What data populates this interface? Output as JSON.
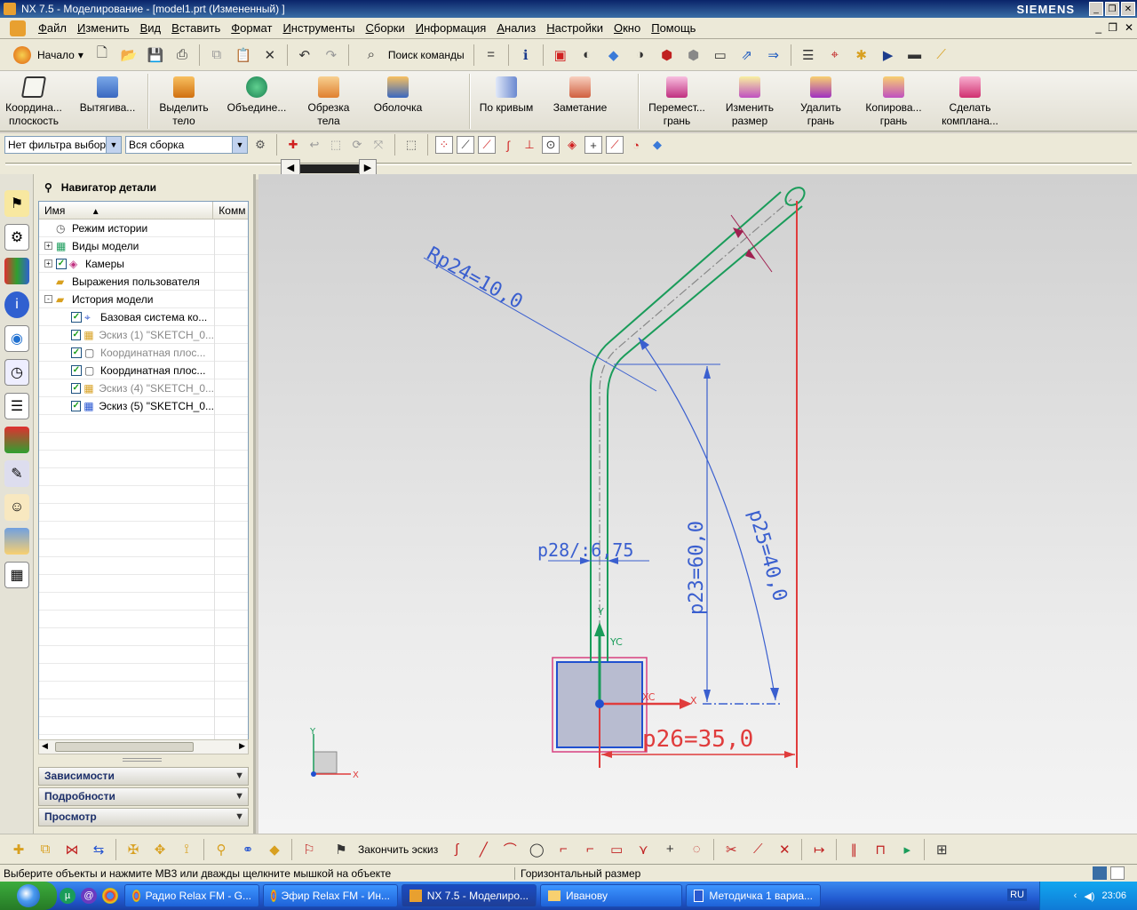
{
  "window": {
    "title": "NX 7.5 - Моделирование - [model1.prt (Измененный) ]",
    "brand": "SIEMENS"
  },
  "menu": {
    "items": [
      "Файл",
      "Изменить",
      "Вид",
      "Вставить",
      "Формат",
      "Инструменты",
      "Сборки",
      "Информация",
      "Анализ",
      "Настройки",
      "Окно",
      "Помощь"
    ]
  },
  "toolbar": {
    "start_label": "Начало",
    "search_label": "Поиск команды"
  },
  "ribbon": {
    "buttons": [
      {
        "line1": "Координа...",
        "line2": "плоскость"
      },
      {
        "line1": "Вытягива...",
        "line2": ""
      },
      {
        "line1": "Выделить",
        "line2": "тело"
      },
      {
        "line1": "Объедине...",
        "line2": ""
      },
      {
        "line1": "Обрезка",
        "line2": "тела"
      },
      {
        "line1": "Оболочка",
        "line2": ""
      },
      {
        "line1": "По кривым",
        "line2": ""
      },
      {
        "line1": "Заметание",
        "line2": ""
      },
      {
        "line1": "Перемест...",
        "line2": "грань"
      },
      {
        "line1": "Изменить",
        "line2": "размер"
      },
      {
        "line1": "Удалить",
        "line2": "грань"
      },
      {
        "line1": "Копирова...",
        "line2": "грань"
      },
      {
        "line1": "Сделать",
        "line2": "комплана..."
      }
    ]
  },
  "filter": {
    "selection_filter": "Нет фильтра выбор",
    "assembly_scope": "Вся сборка"
  },
  "navigator": {
    "title": "Навигатор детали",
    "col_name": "Имя",
    "col_comment": "Комм",
    "rows": [
      {
        "label": "Режим истории",
        "indent": 0,
        "expander": "",
        "check": false,
        "grey": false
      },
      {
        "label": "Виды модели",
        "indent": 0,
        "expander": "+",
        "check": false,
        "grey": false
      },
      {
        "label": "Камеры",
        "indent": 0,
        "expander": "+",
        "check": true,
        "grey": false
      },
      {
        "label": "Выражения пользователя",
        "indent": 0,
        "expander": "",
        "check": false,
        "grey": false
      },
      {
        "label": "История модели",
        "indent": 0,
        "expander": "-",
        "check": false,
        "grey": false
      },
      {
        "label": "Базовая система ко...",
        "indent": 1,
        "expander": "",
        "check": true,
        "grey": false
      },
      {
        "label": "Эскиз (1) \"SKETCH_0...",
        "indent": 1,
        "expander": "",
        "check": true,
        "grey": true
      },
      {
        "label": "Координатная плос...",
        "indent": 1,
        "expander": "",
        "check": true,
        "grey": true
      },
      {
        "label": "Координатная плос...",
        "indent": 1,
        "expander": "",
        "check": true,
        "grey": false
      },
      {
        "label": "Эскиз (4) \"SKETCH_0...",
        "indent": 1,
        "expander": "",
        "check": true,
        "grey": true
      },
      {
        "label": "Эскиз (5) \"SKETCH_0...",
        "indent": 1,
        "expander": "",
        "check": true,
        "grey": false
      }
    ],
    "panels": [
      "Зависимости",
      "Подробности",
      "Просмотр"
    ]
  },
  "sketch": {
    "dims": {
      "rp24": "Rp24=10,0",
      "p23": "p23=60,0",
      "p25": "p25=40,0",
      "p26": "p26=35,0",
      "overlap": "p28/:6,75"
    },
    "axis_x": "X",
    "axis_y": "Y",
    "axis_xc": "XC",
    "axis_yc": "YC",
    "colors": {
      "path": "#1a9c5a",
      "dim": "#3a5fcf",
      "red": "#e03c3c",
      "magenta": "#a02050"
    }
  },
  "bottom_toolbar": {
    "finish_sketch": "Закончить эскиз"
  },
  "status": {
    "prompt": "Выберите объекты и нажмите МВ3 или дважды щелкните мышкой на объекте",
    "mode": "Горизонтальный размер"
  },
  "taskbar": {
    "items": [
      "Радио Relax FM - G...",
      "Эфир Relax FM - Ин...",
      "NX 7.5 - Моделиро...",
      "Иванову",
      "Методичка 1 вариа..."
    ],
    "lang": "RU",
    "clock": "23:06"
  }
}
